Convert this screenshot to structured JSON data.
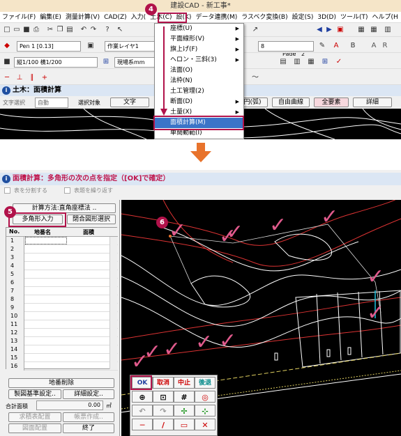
{
  "window": {
    "title": "建設CAD - 新工事*"
  },
  "menu": [
    "ファイル(F)",
    "編集(E)",
    "測量計算(V)",
    "CAD(Z)",
    "入力(",
    "土木(C)",
    "設(K)",
    "データ連携(M)",
    "ラスベク変換(B)",
    "設定(S)",
    "3D(D)",
    "ツール(T)",
    "ヘルプ(H"
  ],
  "toolbar": {
    "page_label": "Page",
    "page_number": "2",
    "pen_label": "Pen 1 [0.13]",
    "layer_label": "作業レイヤ1",
    "scale_label": "縦1/100 横1/200",
    "unit_label": "現場系mm",
    "line_width": "8"
  },
  "top_header": {
    "title": "土木：面積計算"
  },
  "top_options": {
    "text_select_label": "文字選択",
    "text_select_value": "自動",
    "target_label": "選択対象",
    "text_btn": "文字",
    "circle_btn": "円(弧)",
    "free_curve_btn": "自由曲線",
    "all_btn": "全要素",
    "detail_btn": "詳細"
  },
  "dropdown": {
    "items": [
      "座標(U)",
      "平面線形(V)",
      "旗上げ(F)",
      "ヘロン・三斜(3)",
      "法面(O)",
      "法枠(N)",
      "土工管理(2)",
      "断面(D)",
      "土量(X)",
      "面積計算(M)",
      "単簡動範(I)"
    ],
    "selected_index": 9
  },
  "badges": {
    "b4": "4",
    "b5": "5",
    "b6": "6"
  },
  "bottom_header": {
    "title": "面積計算：多角形の次の点を指定（[OK]で確定）"
  },
  "options": {
    "split_table": "表を分割する",
    "repeat_header": "表題を繰り返す"
  },
  "calc_method": "計算方法:直角座標法 ..",
  "polygon_input": "多角形入力",
  "closed_shape_select": "閉合図形選択",
  "table": {
    "headers": [
      "No.",
      "地番名",
      "面積"
    ],
    "rows": [
      "1",
      "2",
      "3",
      "4",
      "5",
      "6",
      "7",
      "8",
      "9",
      "10",
      "11",
      "12",
      "13",
      "14",
      "15",
      "16"
    ]
  },
  "lot_delete": "地番削除",
  "drawing_base": "製図基準設定..",
  "detail_settings": "詳細設定..",
  "total_label": "合計面積",
  "total_value": "0.00",
  "total_unit": "㎡",
  "request_table": "求積表配置",
  "create_table": "帳票作成..",
  "diagram_place": "図面配置",
  "finish": "終了",
  "palette": {
    "ok": "OK",
    "cancel": "取消",
    "stop": "中止",
    "back": "後退"
  }
}
